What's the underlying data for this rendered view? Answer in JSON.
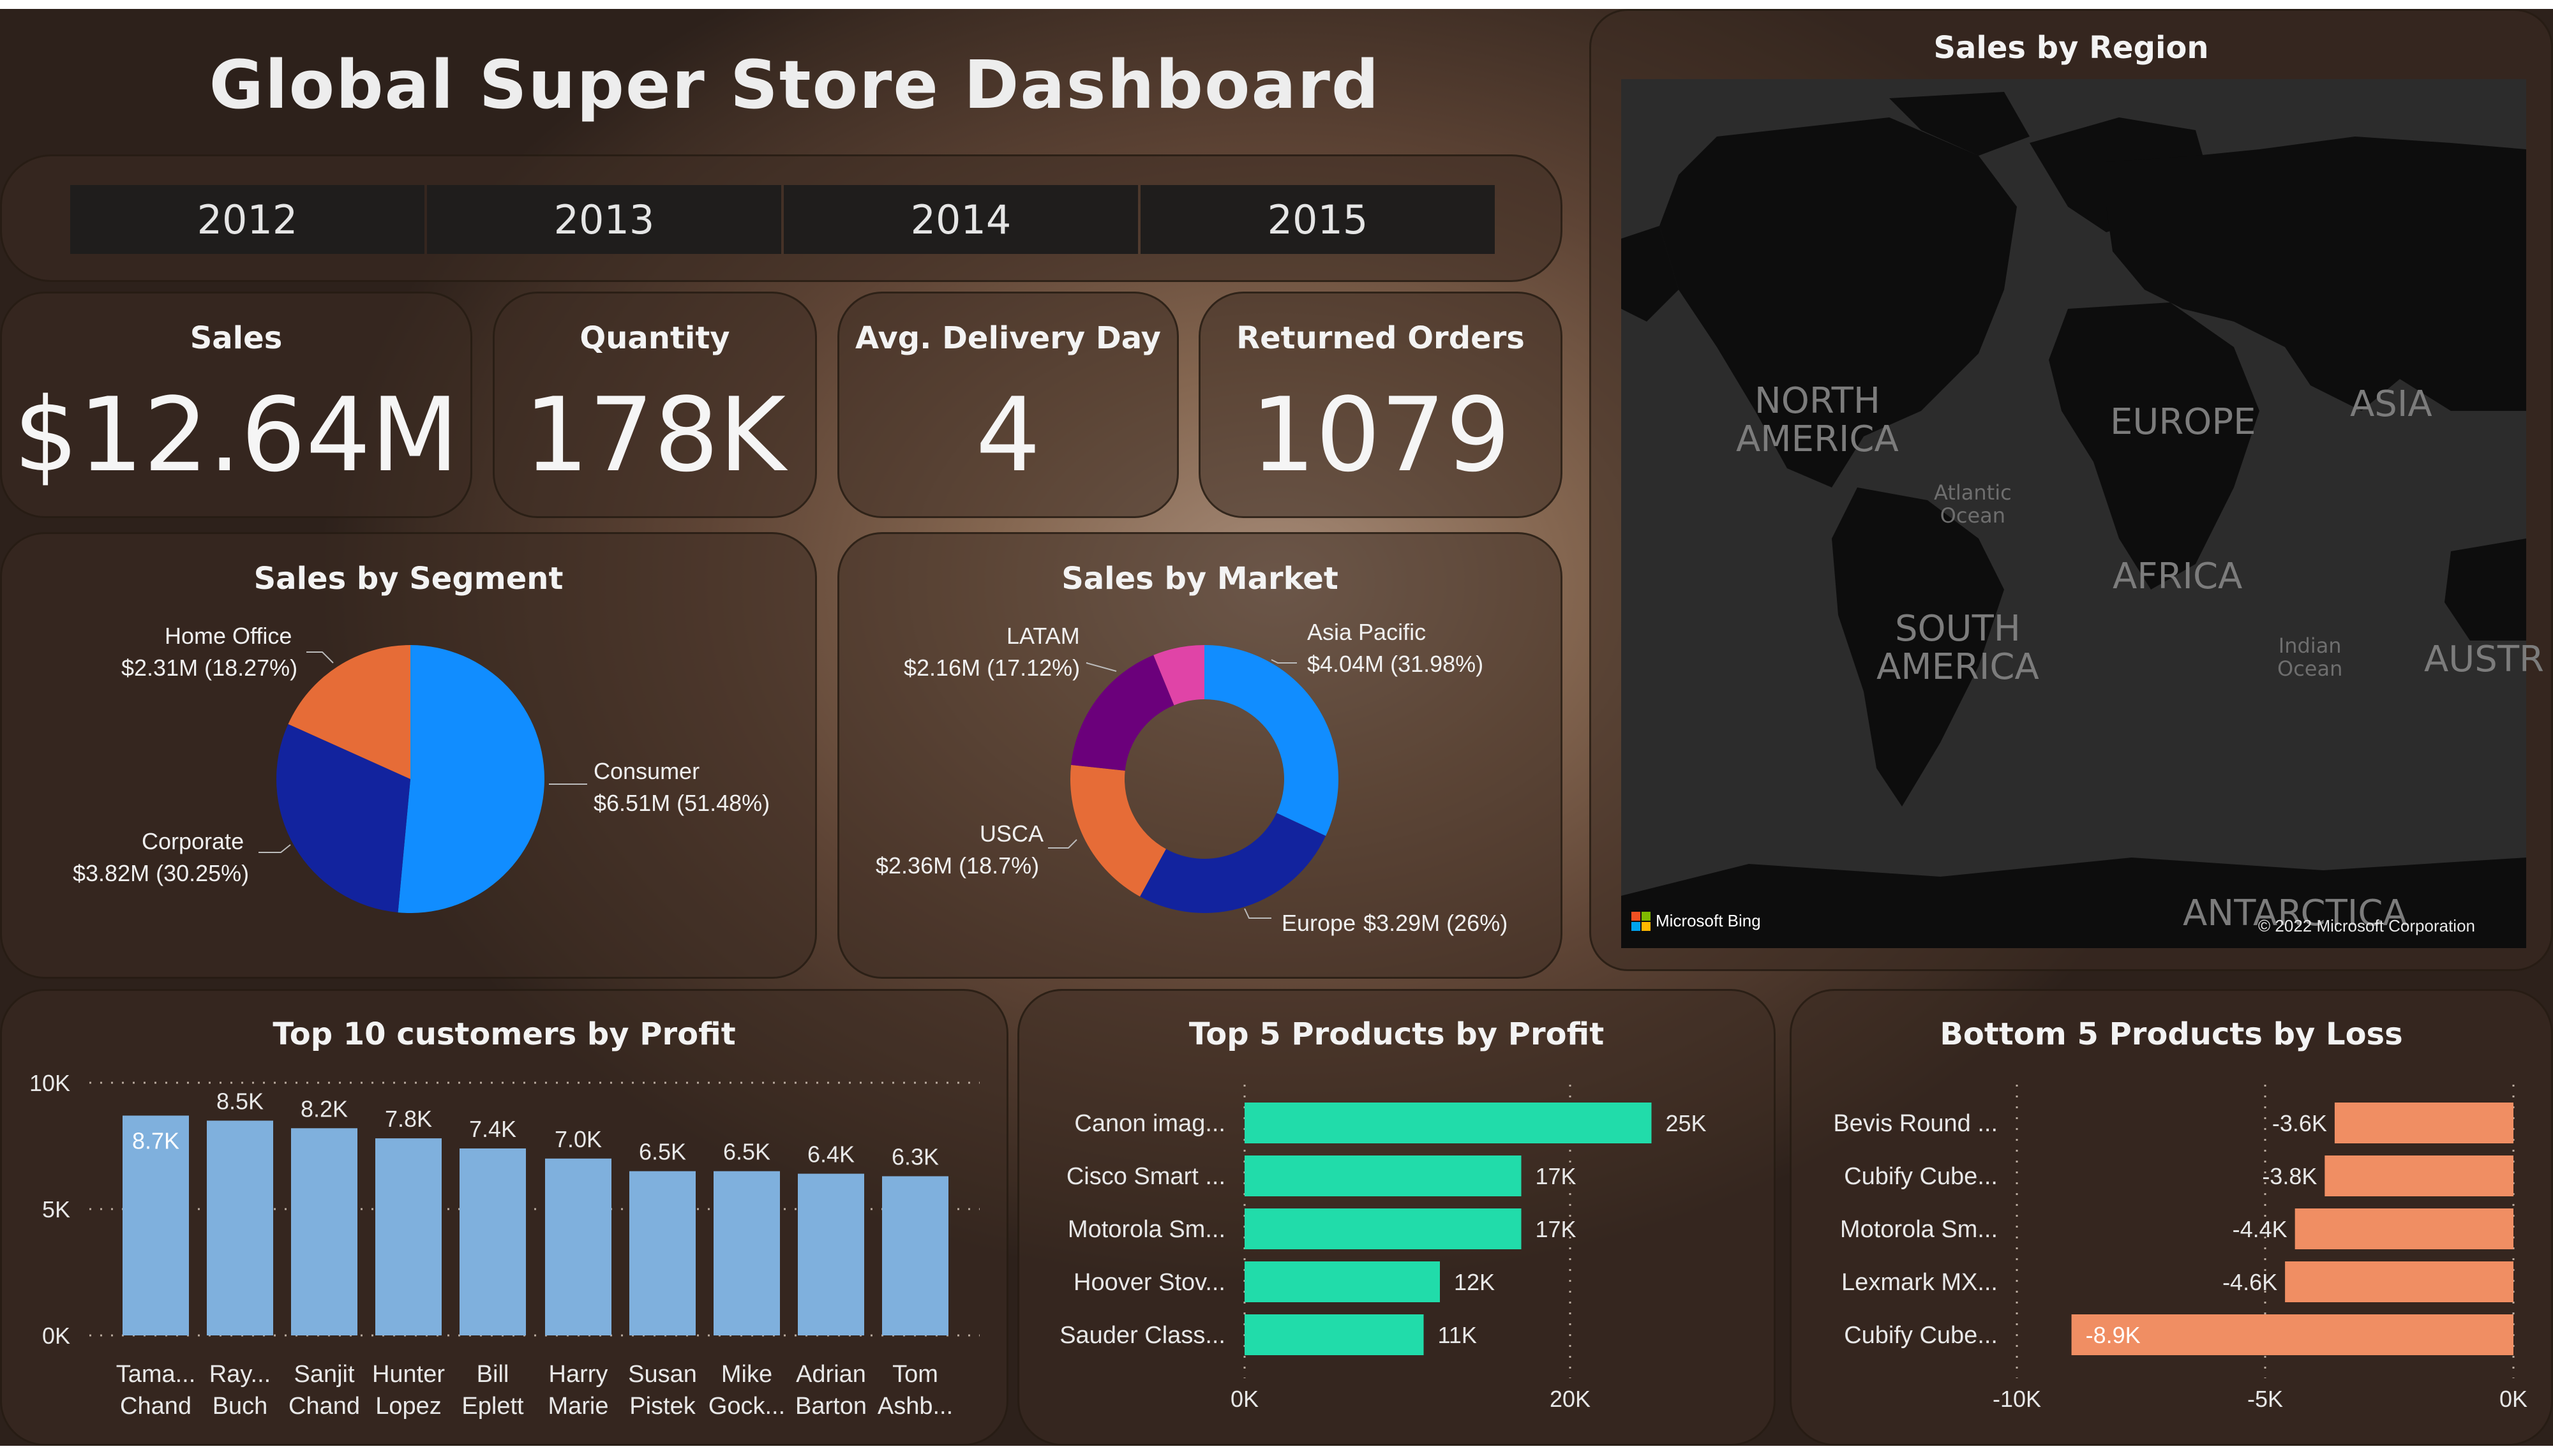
{
  "title": "Global Super Store Dashboard",
  "years": [
    "2012",
    "2013",
    "2014",
    "2015"
  ],
  "kpis": [
    {
      "label": "Sales",
      "value": "$12.64M"
    },
    {
      "label": "Quantity",
      "value": "178K"
    },
    {
      "label": "Avg. Delivery Day",
      "value": "4"
    },
    {
      "label": "Returned Orders",
      "value": "1079"
    }
  ],
  "map": {
    "title": "Sales by Region",
    "labels": {
      "north_america": [
        "NORTH",
        "AMERICA"
      ],
      "europe": "EUROPE",
      "asia": "ASIA",
      "atlantic": [
        "Atlantic",
        "Ocean"
      ],
      "africa": "AFRICA",
      "south_america": [
        "SOUTH",
        "AMERICA"
      ],
      "indian": [
        "Indian",
        "Ocean"
      ],
      "australia": "AUSTR",
      "antarctica": "ANTARCTICA"
    },
    "attribution": "Microsoft Bing",
    "copyright": "© 2022 Microsoft Corporation"
  },
  "colors": {
    "consumer": "#118dff",
    "corporate": "#12239e",
    "home_office": "#e66c37",
    "latam": "#6b007b",
    "pink": "#e044a7",
    "customer_bars": "#7fb0dd",
    "top_products": "#21dcaa",
    "bottom_products": "#f08e63"
  },
  "chart_data": [
    {
      "type": "pie",
      "title": "Sales by Segment",
      "slices": [
        {
          "name": "Consumer",
          "value": 6.51,
          "percent": 51.48,
          "label": "$6.51M (51.48%)"
        },
        {
          "name": "Corporate",
          "value": 3.82,
          "percent": 30.25,
          "label": "$3.82M (30.25%)"
        },
        {
          "name": "Home Office",
          "value": 2.31,
          "percent": 18.27,
          "label": "$2.31M (18.27%)"
        }
      ]
    },
    {
      "type": "pie",
      "title": "Sales by Market",
      "donut": true,
      "slices": [
        {
          "name": "Asia Pacific",
          "value": 4.04,
          "percent": 31.98,
          "label": "$4.04M (31.98%)"
        },
        {
          "name": "Europe",
          "value": 3.29,
          "percent": 26,
          "label": "$3.29M (26%)"
        },
        {
          "name": "USCA",
          "value": 2.36,
          "percent": 18.7,
          "label": "$2.36M (18.7%)"
        },
        {
          "name": "LATAM",
          "value": 2.16,
          "percent": 17.12,
          "label": "$2.16M (17.12%)"
        },
        {
          "name": "",
          "value": 0.79,
          "percent": 6.2,
          "label": ""
        }
      ]
    },
    {
      "type": "bar",
      "title": "Top 10 customers by Profit",
      "categories": [
        [
          "Tama...",
          "Chand"
        ],
        [
          "Ray...",
          "Buch"
        ],
        [
          "Sanjit",
          "Chand"
        ],
        [
          "Hunter",
          "Lopez"
        ],
        [
          "Bill",
          "Eplett"
        ],
        [
          "Harry",
          "Marie"
        ],
        [
          "Susan",
          "Pistek"
        ],
        [
          "Mike",
          "Gock..."
        ],
        [
          "Adrian",
          "Barton"
        ],
        [
          "Tom",
          "Ashb..."
        ]
      ],
      "values": [
        8700,
        8500,
        8200,
        7800,
        7400,
        7000,
        6500,
        6500,
        6400,
        6300
      ],
      "data_labels": [
        "8.7K",
        "8.5K",
        "8.2K",
        "7.8K",
        "7.4K",
        "7.0K",
        "6.5K",
        "6.5K",
        "6.4K",
        "6.3K"
      ],
      "ylim": [
        0,
        10000
      ],
      "yticks": [
        "0K",
        "5K",
        "10K"
      ],
      "grid": true
    },
    {
      "type": "bar",
      "orientation": "horizontal",
      "title": "Top 5 Products by Profit",
      "categories": [
        "Canon imag...",
        "Cisco Smart ...",
        "Motorola Sm...",
        "Hoover Stov...",
        "Sauder Class..."
      ],
      "values": [
        25000,
        17000,
        17000,
        12000,
        11000
      ],
      "data_labels": [
        "25K",
        "17K",
        "17K",
        "12K",
        "11K"
      ],
      "xlim": [
        0,
        27000
      ],
      "xticks": [
        "0K",
        "20K"
      ],
      "grid": true
    },
    {
      "type": "bar",
      "orientation": "horizontal",
      "title": "Bottom 5 Products by Loss",
      "categories": [
        "Bevis Round ...",
        "Cubify Cube...",
        "Motorola Sm...",
        "Lexmark MX...",
        "Cubify Cube..."
      ],
      "values": [
        -3600,
        -3800,
        -4400,
        -4600,
        -8900
      ],
      "data_labels": [
        "-3.6K",
        "-3.8K",
        "-4.4K",
        "-4.6K",
        "-8.9K"
      ],
      "xlim": [
        -10000,
        0
      ],
      "xticks": [
        "-10K",
        "-5K",
        "0K"
      ],
      "grid": true
    }
  ]
}
